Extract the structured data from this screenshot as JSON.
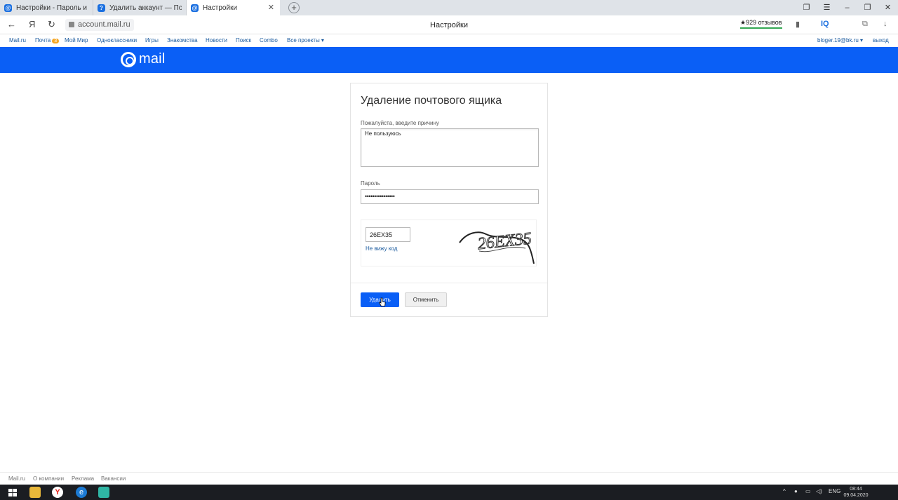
{
  "browser": {
    "tabs": [
      {
        "title": "Настройки - Пароль и бе"
      },
      {
        "title": "Удалить аккаунт — Помо"
      },
      {
        "title": "Настройки"
      }
    ],
    "url": "account.mail.ru",
    "page_title": "Настройки",
    "reviews": "★929 отзывов",
    "yandex_letter": "Я"
  },
  "portal_nav": {
    "items": [
      "Mail.ru",
      "Почта",
      "Мой Мир",
      "Одноклассники",
      "Игры",
      "Знакомства",
      "Новости",
      "Поиск",
      "Combo",
      "Все проекты ▾"
    ],
    "mail_badge": "3",
    "user": "bloger.19@bk.ru ▾",
    "logout": "выход"
  },
  "header": {
    "logo_text": "mail",
    "bg_color": "#0a5ff6"
  },
  "dialog": {
    "title": "Удаление почтового ящика",
    "reason_label": "Пожалуйста, введите причину",
    "reason_value": "Не пользуюсь",
    "password_label": "Пароль",
    "password_value": "••••••••••••••••",
    "captcha_value": "26EX35",
    "captcha_link": "Не вижу код",
    "captcha_image_text": "26EX35",
    "delete_button": "Удалить",
    "cancel_button": "Отменить"
  },
  "footer": {
    "links": [
      "Mail.ru",
      "О компании",
      "Реклама",
      "Вакансии"
    ]
  },
  "taskbar": {
    "language": "ENG",
    "time": "08:44",
    "date": "09.04.2020"
  }
}
